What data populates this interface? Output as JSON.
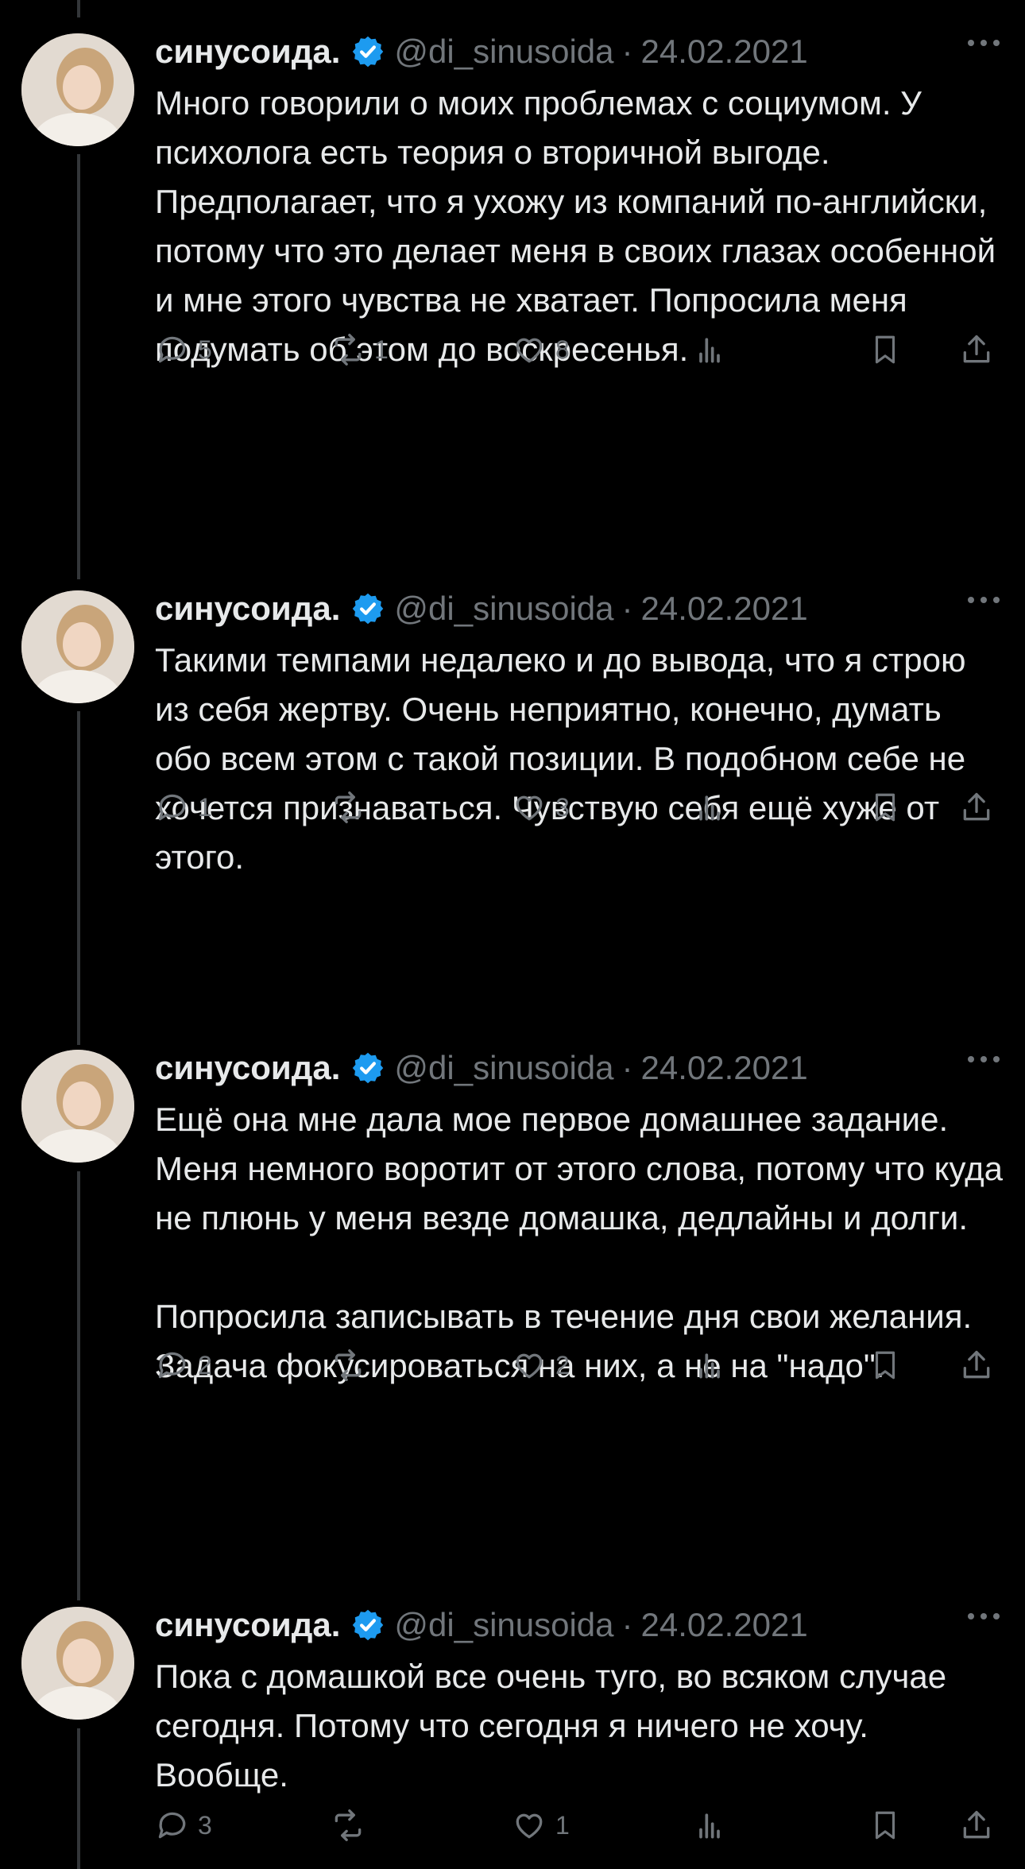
{
  "user": {
    "name": "синусоида.",
    "handle": "@di_sinusoida",
    "verified": true
  },
  "colors": {
    "background": "#000000",
    "text": "#e7e9ea",
    "muted": "#71767b",
    "verified": "#1d9bf0",
    "thread_line": "#333639"
  },
  "icons": [
    "verified-badge-icon",
    "more-icon",
    "reply-icon",
    "retweet-icon",
    "like-icon",
    "views-icon",
    "bookmark-icon",
    "share-icon"
  ],
  "tweets": [
    {
      "date": "24.02.2021",
      "text": "Много говорили о моих проблемах с социумом. У психолога есть теория о вторичной выгоде. Предполагает, что я ухожу из компаний по-английски, потому что это делает меня в своих глазах особенной и мне этого чувства не хватает. Попросила меня подумать об этом до воскресенья.",
      "replies": "5",
      "retweets": "1",
      "likes": "8"
    },
    {
      "date": "24.02.2021",
      "text": "Такими темпами недалеко и до вывода, что я строю из себя жертву. Очень неприятно, конечно, думать обо всем этом с такой позиции. В подобном себе не хочется признаваться. Чувствую себя ещё хуже от этого.",
      "replies": "1",
      "retweets": "",
      "likes": "3"
    },
    {
      "date": "24.02.2021",
      "text": "Ещё она мне дала мое первое домашнее задание. Меня немного воротит от этого слова, потому что куда не плюнь у меня везде домашка, дедлайны и долги.\n\nПопросила записывать в течение дня свои желания. Задача фокусироваться на них, а не на \"надо\".",
      "replies": "2",
      "retweets": "",
      "likes": "2"
    },
    {
      "date": "24.02.2021",
      "text": "Пока с домашкой все очень туго, во всяком случае сегодня. Потому что сегодня я ничего не хочу. Вообще.",
      "replies": "3",
      "retweets": "",
      "likes": "1"
    }
  ]
}
